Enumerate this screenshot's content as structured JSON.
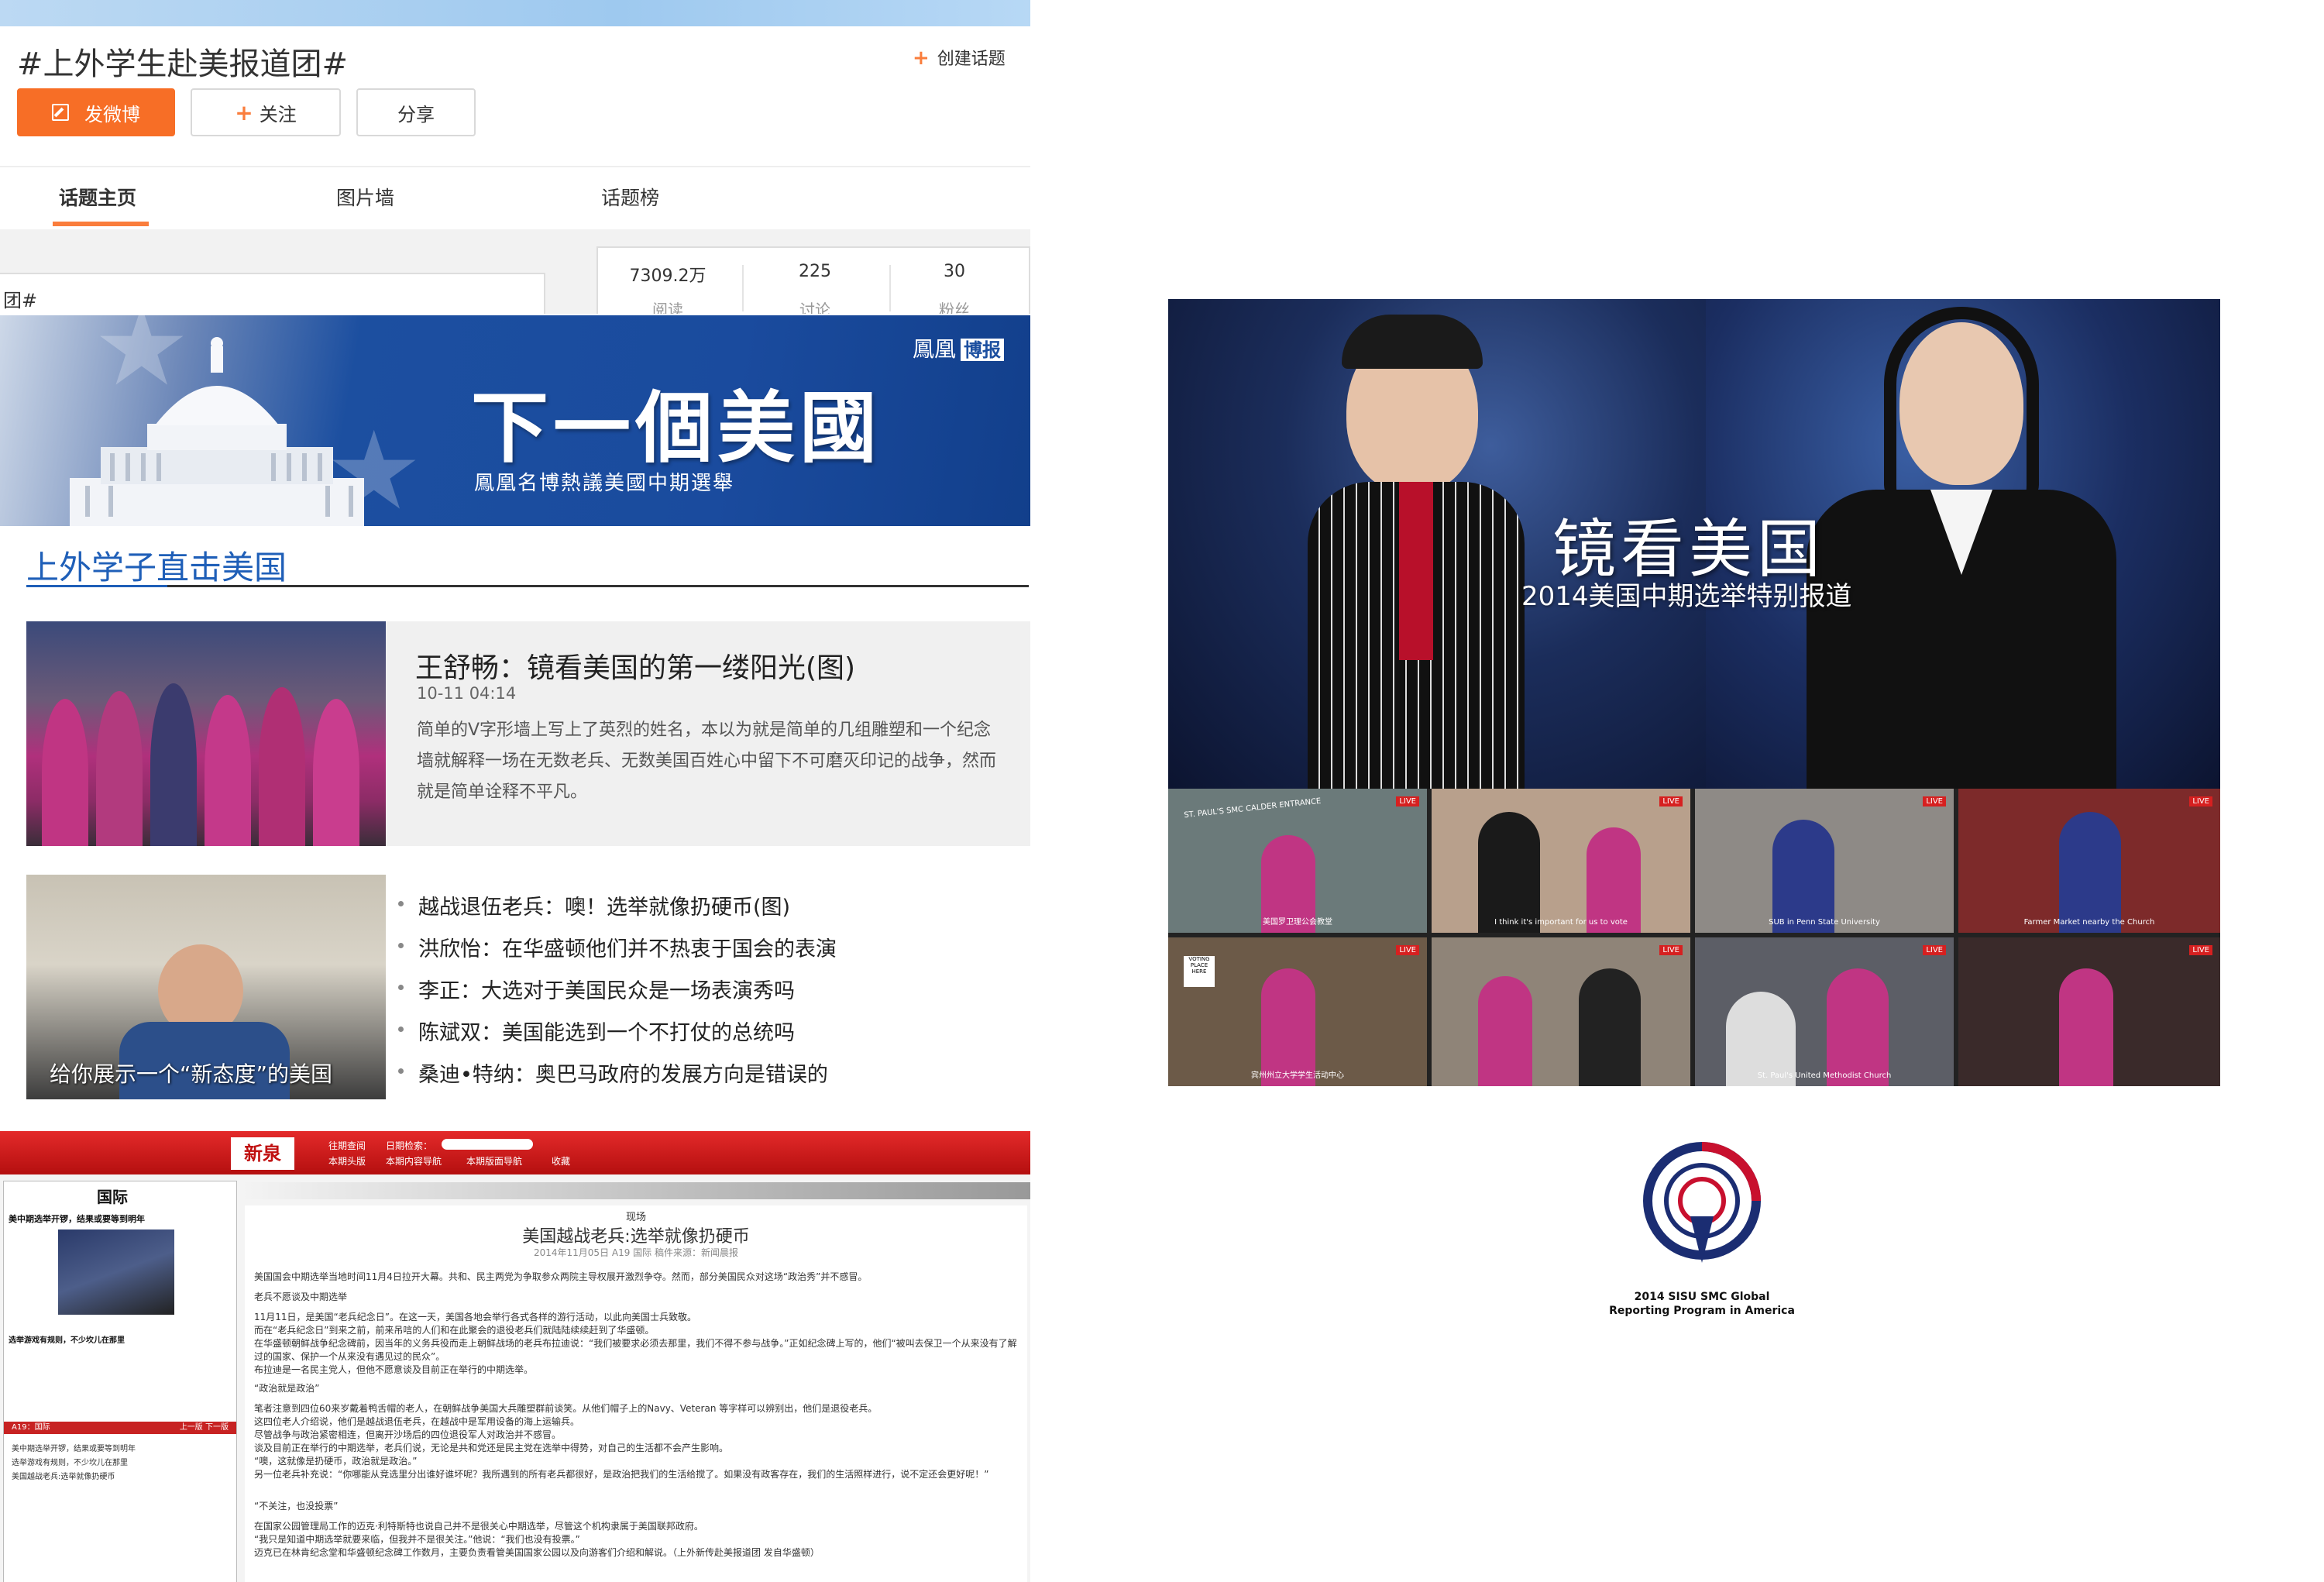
{
  "weibo": {
    "topic_title": "#上外学生赴美报道团#",
    "create_topic": "创建话题",
    "post_button": "发微博",
    "follow_button": "关注",
    "share_button": "分享",
    "tabs": [
      {
        "label": "话题主页",
        "active": true
      },
      {
        "label": "图片墙",
        "active": false
      },
      {
        "label": "话题榜",
        "active": false
      }
    ],
    "search_value": "团#",
    "stats": [
      {
        "value": "7309.2万",
        "label": "阅读"
      },
      {
        "value": "225",
        "label": "讨论"
      },
      {
        "value": "30",
        "label": "粉丝"
      }
    ],
    "accent_color": "#fa7d3c"
  },
  "phoenix": {
    "logo_text": "鳳凰",
    "logo_badge": "博报",
    "headline": "下一個美國",
    "subheadline": "鳳凰名博熱議美國中期選舉"
  },
  "sisu": {
    "section_title": "上外学子直击美国",
    "featured": {
      "title": "王舒畅：镜看美国的第一缕阳光(图)",
      "date": "10-11 04:14",
      "excerpt": "简单的V字形墙上写上了英烈的姓名，本以为就是简单的几组雕塑和一个纪念墙就解释一场在无数老兵、无数美国百姓心中留下不可磨灭印记的战争，然而就是简单诠释不平凡。"
    },
    "photo_caption": "给你展示一个“新态度”的美国",
    "related": [
      "越战退伍老兵：噢！选举就像扔硬币(图)",
      "洪欣怡：在华盛顿他们并不热衷于国会的表演",
      "李正：大选对于美国民众是一场表演秀吗",
      "陈斌双：美国能选到一个不打仗的总统吗",
      "桑迪•特纳：奥巴马政府的发展方向是错误的"
    ]
  },
  "newspaper": {
    "logo": "新泉",
    "nav": [
      "往期查阅",
      "日期检索：",
      "本期头版",
      "本期内容导航",
      "本期版面导航",
      "收藏"
    ],
    "page_section": "国际",
    "page_headline": "美中期选举开锣，结果或要等到明年",
    "page_subhead": "选举游戏有规则，不少坎儿在那里",
    "page_list": [
      "美中期选举开锣，结果或要等到明年",
      "选举游戏有规则，不少坎儿在那里",
      "美国越战老兵:选举就像扔硬币"
    ],
    "page_nav": "A19：国际",
    "prev_next": "上一版  下一版",
    "article": {
      "kicker": "现场",
      "headline": "美国越战老兵:选举就像扔硬币",
      "meta": "2014年11月05日   A19   国际   稿件来源：新闻晨报",
      "paragraphs": [
        "美国国会中期选举当地时间11月4日拉开大幕。共和、民主两党为争取参众两院主导权展开激烈争夺。然而，部分美国民众对这场“政治秀”并不感冒。",
        "老兵不愿谈及中期选举",
        "11月11日，是美国“老兵纪念日”。在这一天，美国各地会举行各式各样的游行活动，以此向美国士兵致敬。",
        "而在“老兵纪念日”到来之前，前来吊唁的人们和在此聚会的退役老兵们就陆陆续续赶到了华盛顿。",
        "在华盛顿朝鲜战争纪念碑前，因当年的义务兵役而走上朝鲜战场的老兵布拉迪说：“我们被要求必须去那里，我们不得不参与战争。”正如纪念碑上写的，他们“被叫去保卫一个从来没有了解过的国家、保护一个从来没有遇见过的民众”。",
        "布拉迪是一名民主党人，但他不愿意谈及目前正在举行的中期选举。",
        "“政治就是政治”",
        "笔者注意到四位60来岁戴着鸭舌帽的老人，在朝鲜战争美国大兵雕塑群前谈笑。从他们帽子上的Navy、Veteran 等字样可以辨别出，他们是退役老兵。",
        "这四位老人介绍说，他们是越战退伍老兵，在越战中是军用设备的海上运输兵。",
        "尽管战争与政治紧密相连，但离开沙场后的四位退役军人对政治并不感冒。",
        "谈及目前正在举行的中期选举，老兵们说，无论是共和党还是民主党在选举中得势，对自己的生活都不会产生影响。",
        "“噢，这就像是扔硬币，政治就是政治。”",
        "另一位老兵补充说：“你哪能从竞选里分出谁好谁坏呢？我所遇到的所有老兵都很好，是政治把我们的生活给搅了。如果没有政客存在，我们的生活照样进行，说不定还会更好呢！”",
        "“不关注，也没投票”",
        "在国家公园管理局工作的迈克·利特斯特也说自己并不是很关心中期选举，尽管这个机构隶属于美国联邦政府。",
        "“我只是知道中期选举就要来临，但我并不是很关注。”他说：“我们也没有投票。”",
        "迈克已在林肯纪念堂和华盛顿纪念碑工作数月，主要负责看管美国国家公园以及向游客们介绍和解说。（上外新传赴美报道团   发自华盛顿）"
      ]
    }
  },
  "broadcast": {
    "title": "镜看美国",
    "subtitle": "2014美国中期选举特别报道",
    "live_label": "LIVE",
    "cells": [
      {
        "caption": "美国罗卫理公会教堂",
        "sign": "ST. PAUL'S SMC CALDER ENTRANCE",
        "color": "#6b7a7a"
      },
      {
        "caption": "I think it's important for us to vote",
        "sign": "",
        "color": "#b8a08c"
      },
      {
        "caption": "SUB in Penn State University",
        "sign": "",
        "color": "#8e8a86"
      },
      {
        "caption": "Farmer Market nearby the Church",
        "sign": "",
        "color": "#7d2a2a"
      },
      {
        "caption": "宾州州立大学学生活动中心",
        "sign": "VOTING PLACE HERE",
        "color": "#6c5a48"
      },
      {
        "caption": "",
        "sign": "",
        "color": "#8f8478"
      },
      {
        "caption": "St. Paul's United Methodist Church",
        "sign": "",
        "color": "#5c5e66"
      },
      {
        "caption": "",
        "sign": "",
        "color": "#3a2a2a"
      }
    ]
  },
  "sisu_logo": {
    "line1": "2014 SISU SMC Global",
    "line2": "Reporting Program in America"
  }
}
